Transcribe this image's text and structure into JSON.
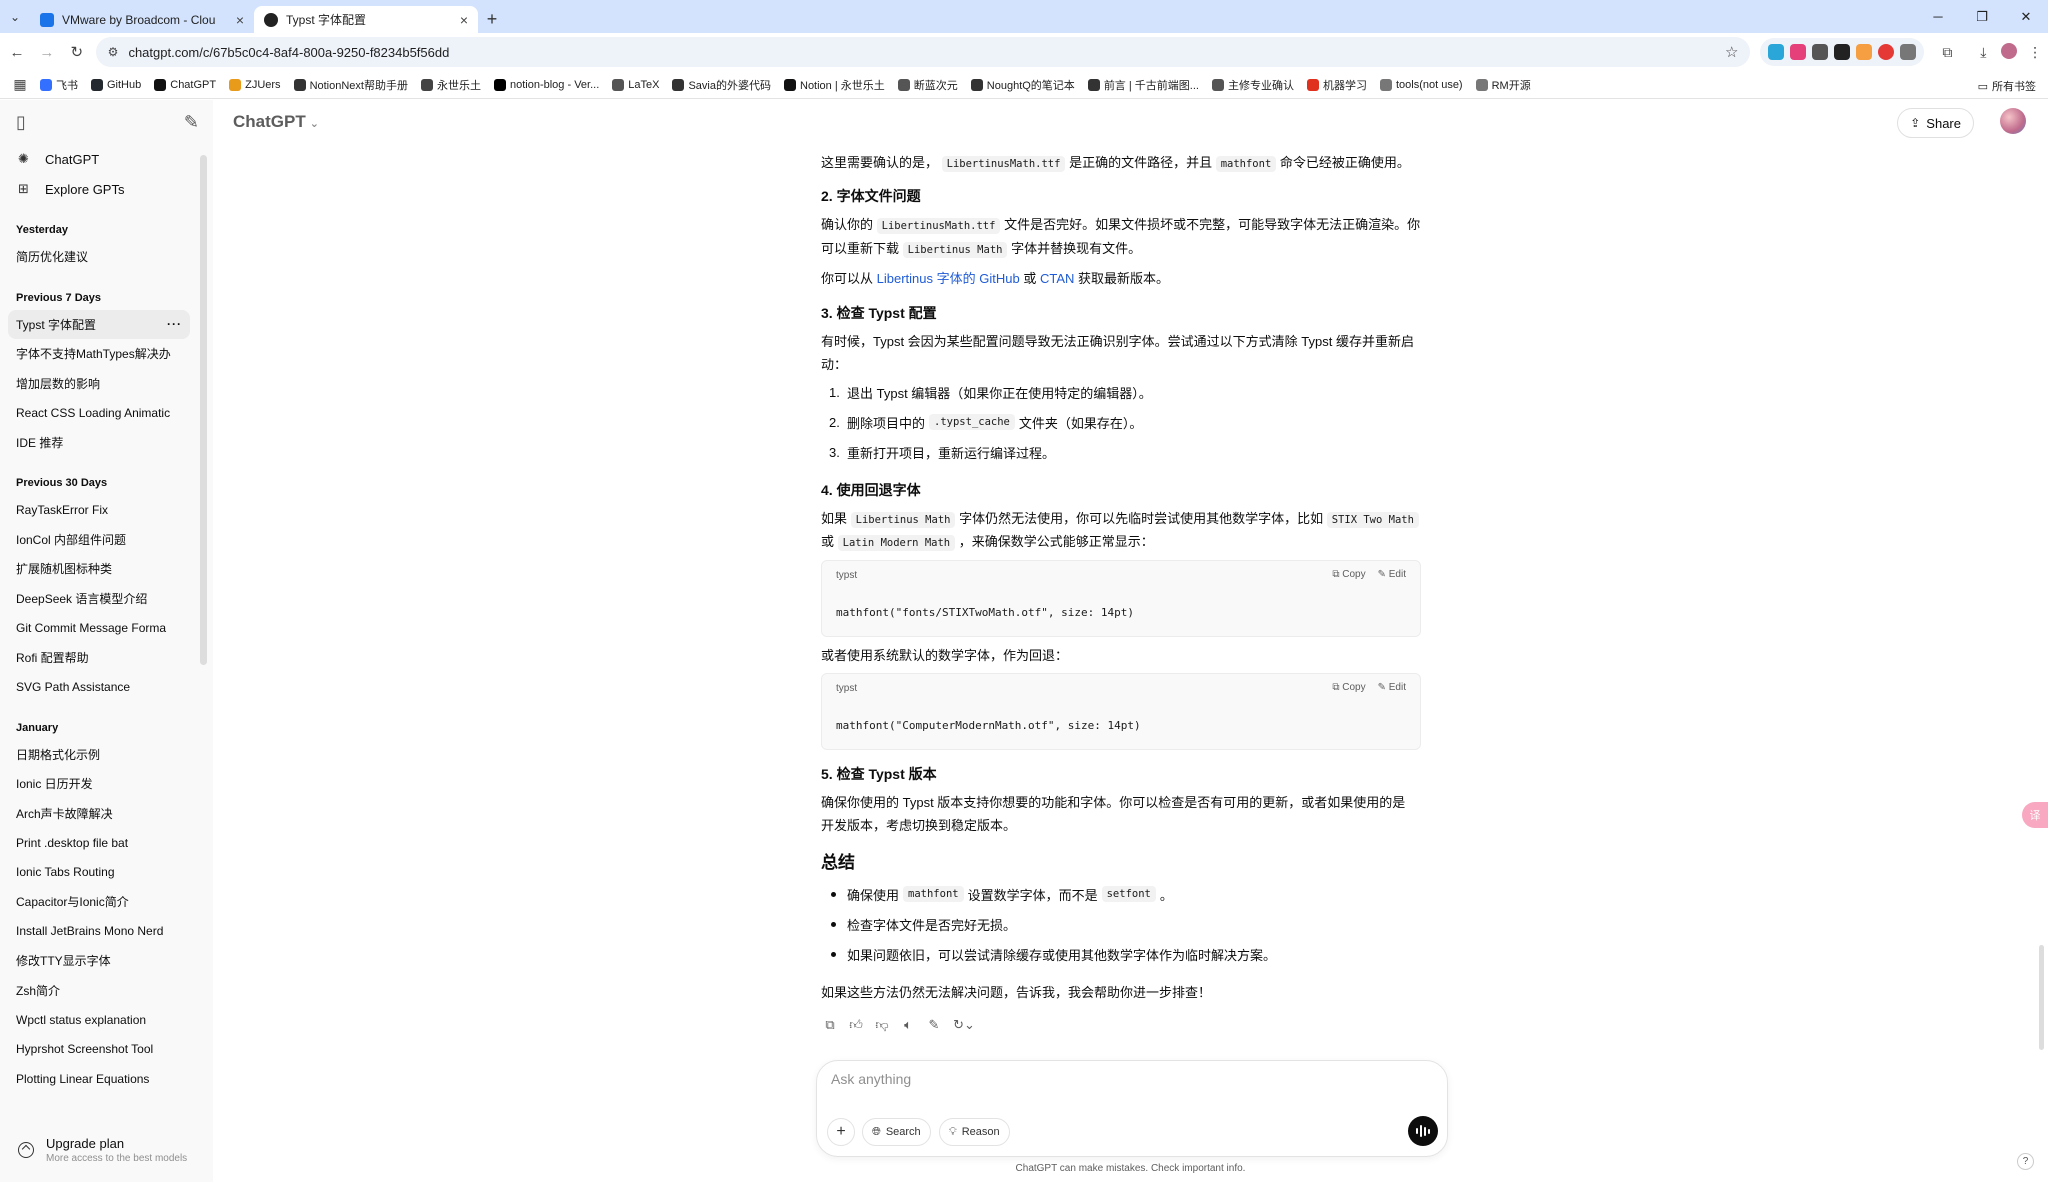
{
  "browser": {
    "tabs": [
      {
        "title": "VMware by Broadcom - Clou",
        "fav_color": "#1a73e8"
      },
      {
        "title": "Typst 字体配置",
        "fav_color": "#222222"
      }
    ],
    "url": "chatgpt.com/c/67b5c0c4-8af4-800a-9250-f8234b5f56dd",
    "bookmarks": [
      {
        "label": "飞书",
        "color": "#3370ff"
      },
      {
        "label": "GitHub",
        "color": "#24292f"
      },
      {
        "label": "ChatGPT",
        "color": "#111111"
      },
      {
        "label": "ZJUers",
        "color": "#e89b1a"
      },
      {
        "label": "NotionNext帮助手册",
        "color": "#333333"
      },
      {
        "label": "永世乐土",
        "color": "#444444"
      },
      {
        "label": "notion-blog - Ver...",
        "color": "#000000"
      },
      {
        "label": "LaTeX",
        "color": "#555555"
      },
      {
        "label": "Savia的外婆代码",
        "color": "#333333"
      },
      {
        "label": "Notion | 永世乐土",
        "color": "#111111"
      },
      {
        "label": "断蓝次元",
        "color": "#555555"
      },
      {
        "label": "NoughtQ的笔记本",
        "color": "#333333"
      },
      {
        "label": "前言 | 千古前端图...",
        "color": "#333333"
      },
      {
        "label": "主修专业确认",
        "color": "#555555"
      },
      {
        "label": "机器学习",
        "color": "#e0301e"
      },
      {
        "label": "tools(not use)",
        "color": "#777777"
      },
      {
        "label": "RM开源",
        "color": "#777777"
      }
    ],
    "bookmarks_right": "所有书签"
  },
  "sidebar": {
    "nav": [
      {
        "label": "ChatGPT"
      },
      {
        "label": "Explore GPTs"
      }
    ],
    "groups": [
      {
        "title": "Yesterday",
        "items": [
          "简历优化建议"
        ]
      },
      {
        "title": "Previous 7 Days",
        "items": [
          "Typst 字体配置",
          "字体不支持MathTypes解决办",
          "增加层数的影响",
          "React CSS Loading Animatic",
          "IDE 推荐"
        ]
      },
      {
        "title": "Previous 30 Days",
        "items": [
          "RayTaskError Fix",
          "IonCol 内部组件问题",
          "扩展随机图标种类",
          "DeepSeek 语言模型介绍",
          "Git Commit Message Forma",
          "Rofi 配置帮助",
          "SVG Path Assistance"
        ]
      },
      {
        "title": "January",
        "items": [
          "日期格式化示例",
          "Ionic 日历开发",
          "Arch声卡故障解决",
          "Print .desktop file bat",
          "Ionic Tabs Routing",
          "Capacitor与Ionic简介",
          "Install JetBrains Mono Nerd",
          "修改TTY显示字体",
          "Zsh简介",
          "Wpctl status explanation",
          "Hyprshot Screenshot Tool",
          "Plotting Linear Equations"
        ]
      }
    ],
    "upgrade_title": "Upgrade plan",
    "upgrade_sub": "More access to the best models"
  },
  "header": {
    "model": "ChatGPT",
    "share": "Share"
  },
  "content": {
    "p1a": "这里需要确认的是，",
    "p1code": "LibertinusMath.ttf",
    "p1b": "是正确的文件路径，并且",
    "p1code2": "mathfont",
    "p1c": "命令已经被正确使用。",
    "h2": "2. 字体文件问题",
    "p2a": "确认你的",
    "p2code": "LibertinusMath.ttf",
    "p2b": "文件是否完好。如果文件损坏或不完整，可能导致字体无法正确渲染。你",
    "p2c": "可以重新下载",
    "p2code2": "Libertinus Math",
    "p2d": "字体并替换现有文件。",
    "p3a": "你可以从",
    "p3link1": "Libertinus 字体的 GitHub",
    "p3b": "或",
    "p3link2": "CTAN",
    "p3c": "获取最新版本。",
    "h3": "3. 检查 Typst 配置",
    "p4a": "有时候，Typst 会因为某些配置问题导致无法正确识别字体。尝试通过以下方式清除 Typst 缓存并重新启",
    "p4b": "动：",
    "steps": [
      {
        "n": "1.",
        "a": "退出 Typst 编辑器（如果你正在使用特定的编辑器）。",
        "code": "",
        "b": ""
      },
      {
        "n": "2.",
        "a": "删除项目中的",
        "code": ".typst_cache",
        "b": "文件夹（如果存在）。"
      },
      {
        "n": "3.",
        "a": "重新打开项目，重新运行编译过程。",
        "code": "",
        "b": ""
      }
    ],
    "h4": "4. 使用回退字体",
    "p5a": "如果",
    "p5code": "Libertinus Math",
    "p5b": "字体仍然无法使用，你可以先临时尝试使用其他数学字体，比如",
    "p5code2": "STIX Two Math",
    "p5c": "或",
    "p5code3": "Latin Modern Math",
    "p5d": "，来确保数学公式能够正常显示：",
    "code1": {
      "lang": "typst",
      "copy": "Copy",
      "edit": "Edit",
      "code": "mathfont(\"fonts/STIXTwoMath.otf\", size: 14pt)"
    },
    "p6": "或者使用系统默认的数学字体，作为回退：",
    "code2": {
      "lang": "typst",
      "copy": "Copy",
      "edit": "Edit",
      "code": "mathfont(\"ComputerModernMath.otf\", size: 14pt)"
    },
    "h5": "5. 检查 Typst 版本",
    "p7a": "确保你使用的 Typst 版本支持你想要的功能和字体。你可以检查是否有可用的更新，或者如果使用的是",
    "p7b": "开发版本，考虑切换到稳定版本。",
    "h6": "总结",
    "bullets": [
      {
        "a": "确保使用",
        "code": "mathfont",
        "b": "设置数学字体，而不是",
        "code2": "setfont",
        "c": "。"
      },
      {
        "a": "检查字体文件是否完好无损。"
      },
      {
        "a": "如果问题依旧，可以尝试清除缓存或使用其他数学字体作为临时解决方案。"
      }
    ],
    "p8": "如果这些方法仍然无法解决问题，告诉我，我会帮助你进一步排查！"
  },
  "composer": {
    "placeholder": "Ask anything",
    "search": "Search",
    "reason": "Reason"
  },
  "disclaimer": "ChatGPT can make mistakes. Check important info.",
  "help": "?",
  "translate": "译"
}
